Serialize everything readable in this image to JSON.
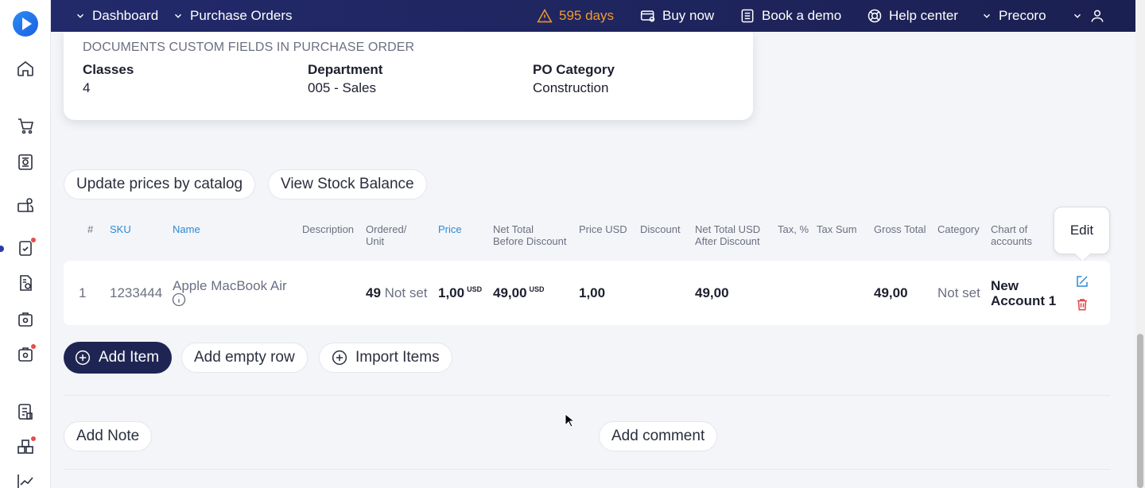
{
  "topbar": {
    "dashboard": "Dashboard",
    "purchase_orders": "Purchase Orders",
    "days": "595 days",
    "buy_now": "Buy now",
    "book_demo": "Book a demo",
    "help_center": "Help center",
    "company": "Precoro"
  },
  "card": {
    "title": "DOCUMENTS CUSTOM FIELDS IN PURCHASE ORDER",
    "fields": [
      {
        "label": "Classes",
        "value": "4"
      },
      {
        "label": "Department",
        "value": "005 - Sales"
      },
      {
        "label": "PO Category",
        "value": "Construction"
      }
    ]
  },
  "actions": {
    "update_prices": "Update prices by catalog",
    "view_stock": "View Stock Balance"
  },
  "table": {
    "headers": {
      "num": "#",
      "sku": "SKU",
      "name": "Name",
      "description": "Description",
      "ordered_1": "Ordered/",
      "ordered_2": "Unit",
      "price": "Price",
      "net_before_1": "Net Total",
      "net_before_2": "Before Discount",
      "price_usd": "Price USD",
      "discount": "Discount",
      "net_after_1": "Net Total USD",
      "net_after_2": "After Discount",
      "tax": "Tax, %",
      "tax_sum": "Tax Sum",
      "gross": "Gross Total",
      "category": "Category",
      "coa_1": "Chart of",
      "coa_2": "accounts"
    },
    "row": {
      "num": "1",
      "sku": "1233444",
      "name": "Apple MacBook Air",
      "ordered_qty": "49",
      "unit": "Not set",
      "price": "1,00",
      "price_currency": "USD",
      "net_before": "49,00",
      "net_before_currency": "USD",
      "price_usd": "1,00",
      "net_after": "49,00",
      "gross": "49,00",
      "category": "Not set",
      "account_1": "New",
      "account_2": "Account 1"
    },
    "tooltip": "Edit"
  },
  "buttons": {
    "add_item": "Add Item",
    "add_empty_row": "Add empty row",
    "import_items": "Import Items",
    "add_note": "Add Note",
    "add_comment": "Add comment"
  },
  "colors": {
    "topbar": "#1f2553",
    "accent_link": "#2a8ad6",
    "warning": "#f39a2d",
    "danger": "#e04848"
  }
}
